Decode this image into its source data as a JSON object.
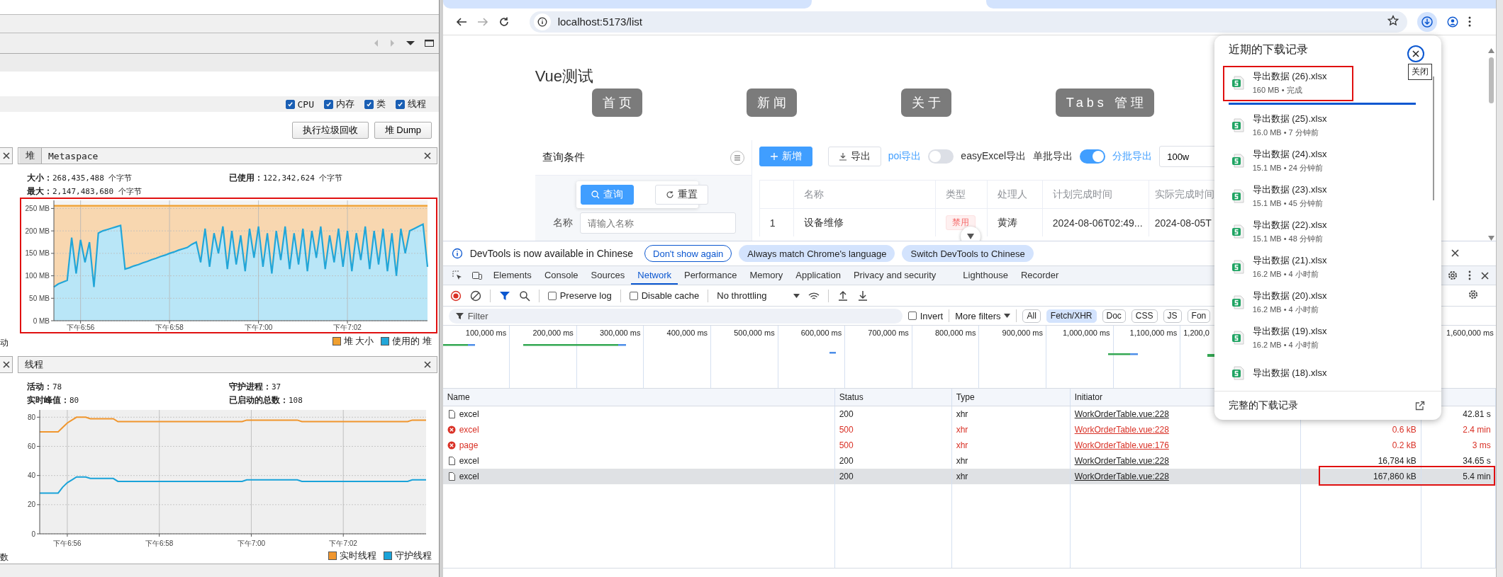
{
  "vm_panel": {
    "graph_toggles": [
      {
        "label": "CPU",
        "checked": true
      },
      {
        "label": "内存",
        "checked": true
      },
      {
        "label": "类",
        "checked": true
      },
      {
        "label": "线程",
        "checked": true
      }
    ],
    "actions": [
      "执行垃圾回收",
      "堆 Dump"
    ],
    "heap": {
      "stub_text": "动",
      "tabs": [
        {
          "label": "堆",
          "selected": true
        },
        {
          "label": "Metaspace",
          "selected": false
        }
      ],
      "stats": [
        {
          "label": "大小：",
          "value": "268,435,488 个字节"
        },
        {
          "label": "已使用：",
          "value": "122,342,624 个字节"
        },
        {
          "label": "最大：",
          "value": "2,147,483,680 个字节"
        }
      ],
      "highlighted": true,
      "chart_data": {
        "type": "area",
        "grid": true,
        "ylim": [
          0,
          268
        ],
        "yticks": [
          {
            "value": 0,
            "label": "0 MB"
          },
          {
            "value": 50,
            "label": "50 MB"
          },
          {
            "value": 100,
            "label": "100 MB"
          },
          {
            "value": 150,
            "label": "150 MB"
          },
          {
            "value": 200,
            "label": "200 MB"
          },
          {
            "value": 250,
            "label": "250 MB"
          }
        ],
        "categories": [
          null,
          null,
          null,
          null,
          null,
          null,
          "下午6:56",
          null,
          null,
          null,
          null,
          null,
          null,
          null,
          null,
          null,
          null,
          null,
          null,
          null,
          null,
          null,
          null,
          null,
          null,
          null,
          "下午6:58",
          null,
          null,
          null,
          null,
          null,
          null,
          null,
          null,
          null,
          null,
          null,
          null,
          null,
          null,
          null,
          null,
          null,
          null,
          null,
          "下午7:00",
          null,
          null,
          null,
          null,
          null,
          null,
          null,
          null,
          null,
          null,
          null,
          null,
          null,
          null,
          null,
          null,
          null,
          null,
          null,
          "下午7:02",
          null,
          null,
          null,
          null,
          null,
          null,
          null,
          null,
          null,
          null,
          null,
          null,
          null,
          null,
          null,
          null,
          null,
          null
        ],
        "series": [
          {
            "name": "堆 大小",
            "color": "#f0a030",
            "values": [
              256,
              256,
              256,
              256,
              256,
              256,
              256,
              256,
              256,
              256,
              256,
              256,
              256,
              256,
              256,
              256,
              256,
              256,
              256,
              256,
              256,
              256,
              256,
              256,
              256,
              256,
              256,
              256,
              256,
              256,
              256,
              256,
              256,
              256,
              256,
              256,
              256,
              256,
              256,
              256,
              256,
              256,
              256,
              256,
              256,
              256,
              256,
              256,
              256,
              256,
              256,
              256,
              256,
              256,
              256,
              256,
              256,
              256,
              256,
              256,
              256,
              256,
              256,
              256,
              256,
              256,
              256,
              256,
              256,
              256,
              256,
              256,
              256,
              256,
              256,
              256,
              256,
              256,
              256,
              256,
              256,
              256,
              256,
              256,
              256
            ]
          },
          {
            "name": "使用的 堆",
            "color": "#22a6d8",
            "values": [
              75,
              82,
              86,
              90,
              185,
              105,
              180,
              130,
              175,
              75,
              195,
              200,
              203,
              206,
              209,
              212,
              115,
              118,
              122,
              125,
              129,
              132,
              136,
              139,
              143,
              146,
              150,
              153,
              157,
              160,
              163,
              170,
              175,
              130,
              205,
              120,
              195,
              150,
              210,
              115,
              200,
              125,
              190,
              110,
              205,
              140,
              210,
              120,
              195,
              105,
              200,
              135,
              210,
              115,
              195,
              125,
              205,
              110,
              200,
              140,
              210,
              115,
              190,
              130,
              205,
              120,
              200,
              110,
              195,
              135,
              210,
              115,
              200,
              125,
              205,
              110,
              195,
              100,
              205,
              150,
              200,
              205,
              210,
              215,
              120
            ]
          }
        ]
      }
    },
    "threads": {
      "stub_text": "数",
      "tab": "线程",
      "stats": [
        {
          "label": "活动：",
          "value": "78"
        },
        {
          "label": "守护进程：",
          "value": "37"
        },
        {
          "label": "实时峰值：",
          "value": "80"
        },
        {
          "label": "已启动的总数：",
          "value": "108"
        }
      ],
      "chart_data": {
        "type": "line",
        "grid": true,
        "ylim": [
          0,
          85
        ],
        "yticks": [
          0,
          20,
          40,
          60,
          80
        ],
        "categories": [
          null,
          null,
          null,
          null,
          null,
          null,
          "下午6:56",
          null,
          null,
          null,
          null,
          null,
          null,
          null,
          null,
          null,
          null,
          null,
          null,
          null,
          null,
          null,
          null,
          null,
          null,
          null,
          "下午6:58",
          null,
          null,
          null,
          null,
          null,
          null,
          null,
          null,
          null,
          null,
          null,
          null,
          null,
          null,
          null,
          null,
          null,
          null,
          null,
          "下午7:00",
          null,
          null,
          null,
          null,
          null,
          null,
          null,
          null,
          null,
          null,
          null,
          null,
          null,
          null,
          null,
          null,
          null,
          null,
          null,
          "下午7:02",
          null,
          null,
          null,
          null,
          null,
          null,
          null,
          null,
          null,
          null,
          null,
          null,
          null,
          null,
          null,
          null,
          null,
          null
        ],
        "series": [
          {
            "name": "实时线程",
            "color": "#f0962e",
            "values": [
              70,
              70,
              70,
              70,
              70,
              73,
              76,
              78,
              80,
              80,
              80,
              79,
              79,
              79,
              79,
              79,
              79,
              77,
              77,
              77,
              77,
              77,
              77,
              77,
              77,
              77,
              77,
              77,
              77,
              77,
              77,
              77,
              77,
              77,
              77,
              77,
              77,
              77,
              77,
              77,
              77,
              77,
              77,
              77,
              77,
              78,
              78,
              78,
              78,
              78,
              78,
              78,
              78,
              78,
              78,
              78,
              78,
              77,
              77,
              77,
              77,
              77,
              77,
              77,
              77,
              77,
              77,
              77,
              77,
              77,
              77,
              77,
              77,
              77,
              77,
              77,
              77,
              77,
              77,
              77,
              77,
              78,
              78,
              78,
              78
            ]
          },
          {
            "name": "守护线程",
            "color": "#1aa3d9",
            "values": [
              28,
              28,
              28,
              28,
              28,
              32,
              35,
              37,
              39,
              39,
              39,
              38,
              38,
              38,
              38,
              38,
              38,
              36,
              36,
              36,
              36,
              36,
              36,
              36,
              36,
              36,
              36,
              36,
              36,
              36,
              36,
              36,
              36,
              36,
              36,
              36,
              36,
              36,
              36,
              36,
              36,
              36,
              36,
              36,
              36,
              37,
              37,
              37,
              37,
              37,
              37,
              37,
              37,
              37,
              37,
              37,
              37,
              36,
              36,
              36,
              36,
              36,
              36,
              36,
              36,
              36,
              36,
              36,
              36,
              36,
              36,
              36,
              36,
              36,
              36,
              36,
              36,
              36,
              36,
              36,
              36,
              37,
              37,
              37,
              37
            ]
          }
        ]
      }
    }
  },
  "browser": {
    "url": "localhost:5173/list"
  },
  "page": {
    "title": "Vue测试",
    "nav": [
      "首页",
      "新闻",
      "关于",
      "Tabs 管理"
    ],
    "query_panel": {
      "title": "查询条件",
      "search_button": "查询",
      "reset_button": "重置",
      "field_label": "名称",
      "placeholder": "请输入名称"
    },
    "toolbar": {
      "add_button": "新增",
      "export_button": "导出",
      "switches": [
        {
          "left": "poi导出",
          "right": "easyExcel导出",
          "on": false
        },
        {
          "left": "单批导出",
          "right": "分批导出",
          "on": true
        }
      ],
      "batch_size": "100w"
    },
    "table": {
      "columns": [
        "名称",
        "类型",
        "处理人",
        "计划完成时间",
        "实际完成时间"
      ],
      "rows": [
        {
          "index": "1",
          "name": "设备维修",
          "type": "禁用",
          "handler": "黄涛",
          "planned": "2024-08-06T02:49...",
          "actual": "2024-08-05T"
        }
      ]
    }
  },
  "downloads": {
    "title": "近期的下载记录",
    "close_tooltip": "关闭",
    "items": [
      {
        "name": "导出数据 (26).xlsx",
        "meta": "160 MB • 完成",
        "level": 1,
        "highlighted": true
      },
      {
        "name": "导出数据 (25).xlsx",
        "meta": "16.0 MB • 7 分钟前",
        "highlighted": false
      },
      {
        "name": "导出数据 (24).xlsx",
        "meta": "15.1 MB • 24 分钟前",
        "highlighted": false
      },
      {
        "name": "导出数据 (23).xlsx",
        "meta": "15.1 MB • 45 分钟前",
        "highlighted": false
      },
      {
        "name": "导出数据 (22).xlsx",
        "meta": "15.1 MB • 48 分钟前",
        "highlighted": false
      },
      {
        "name": "导出数据 (21).xlsx",
        "meta": "16.2 MB • 4 小时前",
        "highlighted": false
      },
      {
        "name": "导出数据 (20).xlsx",
        "meta": "16.2 MB • 4 小时前",
        "highlighted": false
      },
      {
        "name": "导出数据 (19).xlsx",
        "meta": "16.2 MB • 4 小时前",
        "highlighted": false
      },
      {
        "name": "导出数据 (18).xlsx",
        "highlighted": false
      }
    ],
    "footer": "完整的下载记录"
  },
  "devtools": {
    "banner": {
      "text": "DevTools is now available in Chinese",
      "buttons": [
        "Don't show again",
        "Always match Chrome's language",
        "Switch DevTools to Chinese"
      ]
    },
    "tabs": [
      {
        "label": "Elements",
        "selected": false
      },
      {
        "label": "Console",
        "selected": false
      },
      {
        "label": "Sources",
        "selected": false
      },
      {
        "label": "Network",
        "selected": true
      },
      {
        "label": "Performance",
        "selected": false
      },
      {
        "label": "Memory",
        "selected": false
      },
      {
        "label": "Application",
        "selected": false
      },
      {
        "label": "Privacy and security",
        "selected": false
      },
      {
        "label": "Lighthouse",
        "selected": false
      },
      {
        "label": "Recorder",
        "selected": false
      }
    ],
    "toolbar": {
      "options": [
        {
          "label": "Preserve log",
          "checked": false
        },
        {
          "label": "Disable cache",
          "checked": false
        }
      ],
      "throttling": "No throttling"
    },
    "filter": {
      "placeholder": "Filter",
      "invert": {
        "label": "Invert",
        "checked": false
      },
      "more_filters": "More filters",
      "types": [
        {
          "label": "All",
          "selected": false
        },
        {
          "label": "Fetch/XHR",
          "selected": true
        },
        {
          "label": "Doc",
          "selected": false
        },
        {
          "label": "CSS",
          "selected": false
        },
        {
          "label": "JS",
          "selected": false
        },
        {
          "label": "Fon",
          "selected": false
        }
      ]
    },
    "overview": {
      "ticks": [
        "100,000 ms",
        "200,000 ms",
        "300,000 ms",
        "400,000 ms",
        "500,000 ms",
        "600,000 ms",
        "700,000 ms",
        "800,000 ms",
        "900,000 ms",
        "1,000,000 ms",
        "1,100,000 ms",
        "1,200,0"
      ],
      "right_tick": "1,600,000 ms"
    },
    "requests": {
      "columns": [
        "Name",
        "Status",
        "Type",
        "Initiator"
      ],
      "rows": [
        {
          "name": "excel",
          "status": "200",
          "type": "xhr",
          "initiator": "WorkOrderTable.vue:228",
          "time": "42.81 s",
          "error": false,
          "selected": false,
          "highlighted": false
        },
        {
          "name": "excel",
          "status": "500",
          "type": "xhr",
          "initiator": "WorkOrderTable.vue:228",
          "size": "0.6 kB",
          "time": "2.4 min",
          "error": true,
          "selected": false,
          "highlighted": false
        },
        {
          "name": "page",
          "status": "500",
          "type": "xhr",
          "initiator": "WorkOrderTable.vue:176",
          "size": "0.2 kB",
          "time": "3 ms",
          "error": true,
          "selected": false,
          "highlighted": false
        },
        {
          "name": "excel",
          "status": "200",
          "type": "xhr",
          "initiator": "WorkOrderTable.vue:228",
          "size": "16,784 kB",
          "time": "34.65 s",
          "error": false,
          "selected": false,
          "highlighted": false
        },
        {
          "name": "excel",
          "status": "200",
          "type": "xhr",
          "initiator": "WorkOrderTable.vue:228",
          "size": "167,860 kB",
          "time": "5.4 min",
          "error": false,
          "selected": true,
          "highlighted": true
        }
      ]
    }
  }
}
